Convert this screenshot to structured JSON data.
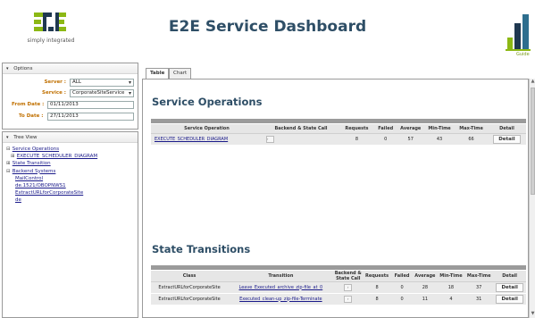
{
  "header": {
    "title": "E2E Service Dashboard",
    "logo_text": "simply integrated",
    "guide_label": "Guide",
    "colors": {
      "brand_green": "#8cb814",
      "brand_navy": "#1f3850",
      "title": "#2e4e66"
    }
  },
  "options": {
    "heading": "Options",
    "server_label": "Server :",
    "server_value": "ALL",
    "service_label": "Service :",
    "service_value": "CorporateSiteService",
    "from_label": "From Date :",
    "from_value": "01/11/2013",
    "to_label": "To Date :",
    "to_value": "27/11/2013"
  },
  "tree": {
    "heading": "Tree View",
    "items": [
      {
        "toggle": "⊟",
        "label": "Service Operations"
      },
      {
        "toggle": "⊞",
        "label": "EXECUTE_SCHEDULER_DIAGRAM"
      },
      {
        "toggle": "⊞",
        "label": "State Transition"
      },
      {
        "toggle": "⊟",
        "label": "Backend Systems"
      },
      {
        "toggle": "",
        "label": "MailControl"
      },
      {
        "toggle": "",
        "label": "de.1521/OBOPNWS1"
      },
      {
        "toggle": "",
        "label": "ExtractURLforCorporateSite"
      },
      {
        "toggle": "",
        "label": "de"
      }
    ]
  },
  "tabs": [
    {
      "label": "Table"
    },
    {
      "label": "Chart"
    }
  ],
  "service_operations": {
    "title": "Service Operations",
    "columns": [
      "Service Operation",
      "Backend & State Call",
      "Requests",
      "Failed",
      "Average",
      "Min-Time",
      "Max-Time",
      "Detail"
    ],
    "rows": [
      {
        "operation": "EXECUTE_SCHEDULER_DIAGRAM",
        "backend": "›",
        "requests": "8",
        "failed": "0",
        "average": "57",
        "min": "43",
        "max": "66",
        "detail": "Detail"
      }
    ]
  },
  "state_transitions": {
    "title": "State Transitions",
    "columns": [
      "Class",
      "Transition",
      "Backend & State Call",
      "Requests",
      "Failed",
      "Average",
      "Min-Time",
      "Max-Time",
      "Detail"
    ],
    "rows": [
      {
        "class": "ExtractURLforCorporateSite",
        "transition": "Leave_Executed_archive_zip-file_at_0",
        "backend": "›",
        "requests": "8",
        "failed": "0",
        "average": "28",
        "min": "18",
        "max": "37",
        "detail": "Detail"
      },
      {
        "class": "ExtractURLforCorporateSite",
        "transition": "Executed_clean-up_zip-file-Terminate",
        "backend": "›",
        "requests": "8",
        "failed": "0",
        "average": "11",
        "min": "4",
        "max": "31",
        "detail": "Detail"
      }
    ]
  }
}
